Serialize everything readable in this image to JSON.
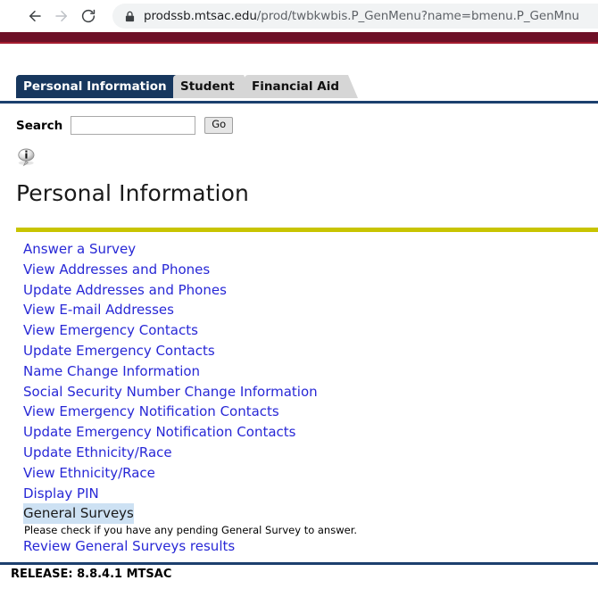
{
  "browser": {
    "back_icon": "arrow-left-icon",
    "forward_icon": "arrow-right-icon",
    "reload_icon": "reload-icon",
    "lock_icon": "lock-icon",
    "url_host": "prodssb.mtsac.edu",
    "url_path": "/prod/twbkwbis.P_GenMenu?name=bmenu.P_GenMnu",
    "url_full": "prodssb.mtsac.edu/prod/twbkwbis.P_GenMenu?name=bmenu.P_GenMnu"
  },
  "colors": {
    "banner_dark": "#6d1027",
    "banner_light": "#a51c30",
    "tab_active": "#17375e",
    "tab_inactive": "#d6d6d6",
    "rule_yellow": "#c8c400",
    "rule_navy": "#1c3f6e",
    "link_blue": "#2828d6",
    "selection_blue": "#cde1f3"
  },
  "tabs": [
    {
      "label": "Personal Information",
      "active": true
    },
    {
      "label": "Student",
      "active": false
    },
    {
      "label": "Financial Aid",
      "active": false
    }
  ],
  "search": {
    "label": "Search",
    "value": "",
    "placeholder": "",
    "button_label": "Go"
  },
  "info_icon": "information-icon",
  "heading": "Personal Information",
  "menu": [
    {
      "label": "Answer a Survey"
    },
    {
      "label": "View Addresses and Phones"
    },
    {
      "label": "Update Addresses and Phones"
    },
    {
      "label": "View E-mail Addresses"
    },
    {
      "label": "View Emergency Contacts"
    },
    {
      "label": "Update Emergency Contacts"
    },
    {
      "label": "Name Change Information"
    },
    {
      "label": "Social Security Number Change Information"
    },
    {
      "label": "View Emergency Notification Contacts"
    },
    {
      "label": "Update Emergency Notification Contacts"
    },
    {
      "label": "Update Ethnicity/Race"
    },
    {
      "label": "View Ethnicity/Race"
    },
    {
      "label": "Display PIN"
    },
    {
      "label": "General Surveys",
      "selected": true,
      "description": "Please check if you have any pending General Survey to answer."
    },
    {
      "label": "Review General Surveys results"
    }
  ],
  "footer": {
    "release": "RELEASE: 8.8.4.1 MTSAC"
  }
}
